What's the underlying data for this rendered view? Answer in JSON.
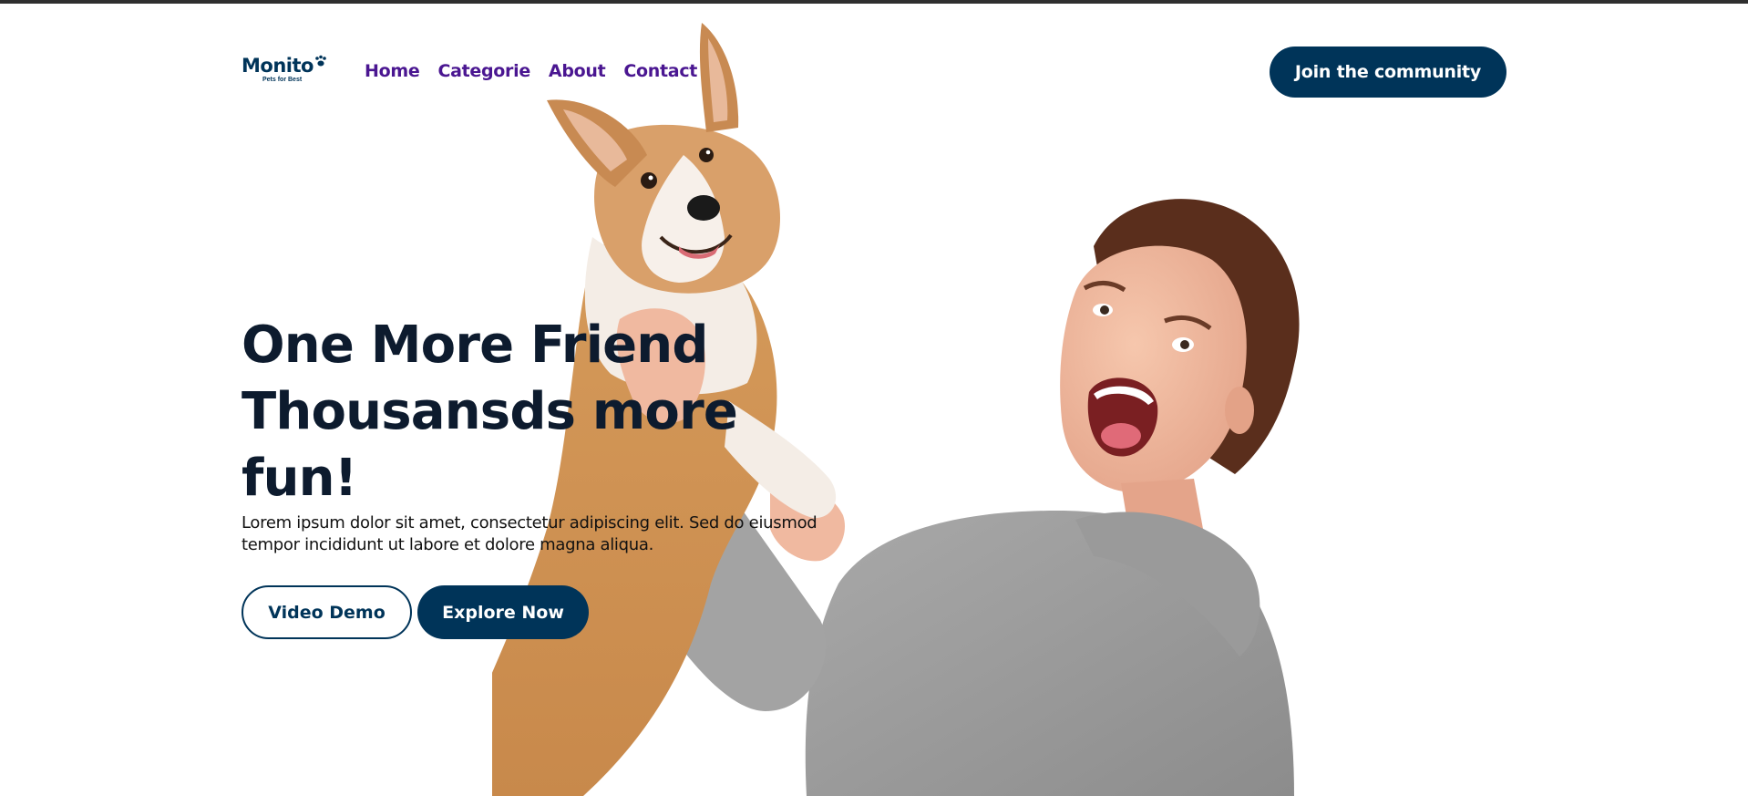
{
  "brand": {
    "logo_text": "Monito",
    "tagline": "Pets for Best",
    "color": "#003459",
    "icon": "paw-icon"
  },
  "nav": {
    "items": [
      "Home",
      "Categorie",
      "About",
      "Contact"
    ],
    "color": "#4a1691"
  },
  "header": {
    "cta_label": "Join the community"
  },
  "hero": {
    "headline": [
      "One More Friend",
      "Thousansds more",
      "fun!"
    ],
    "lead": "Lorem ipsum dolor sit amet, consectetur adipiscing elit. Sed do eiusmod tempor incididunt ut labore et dolore magna aliqua.",
    "primary_button": "Explore Now",
    "secondary_button": "Video Demo",
    "image": "woman-holding-corgi-photo"
  },
  "colors": {
    "primary": "#003459",
    "heading": "#0d1b2e",
    "background": "#ffffff"
  }
}
